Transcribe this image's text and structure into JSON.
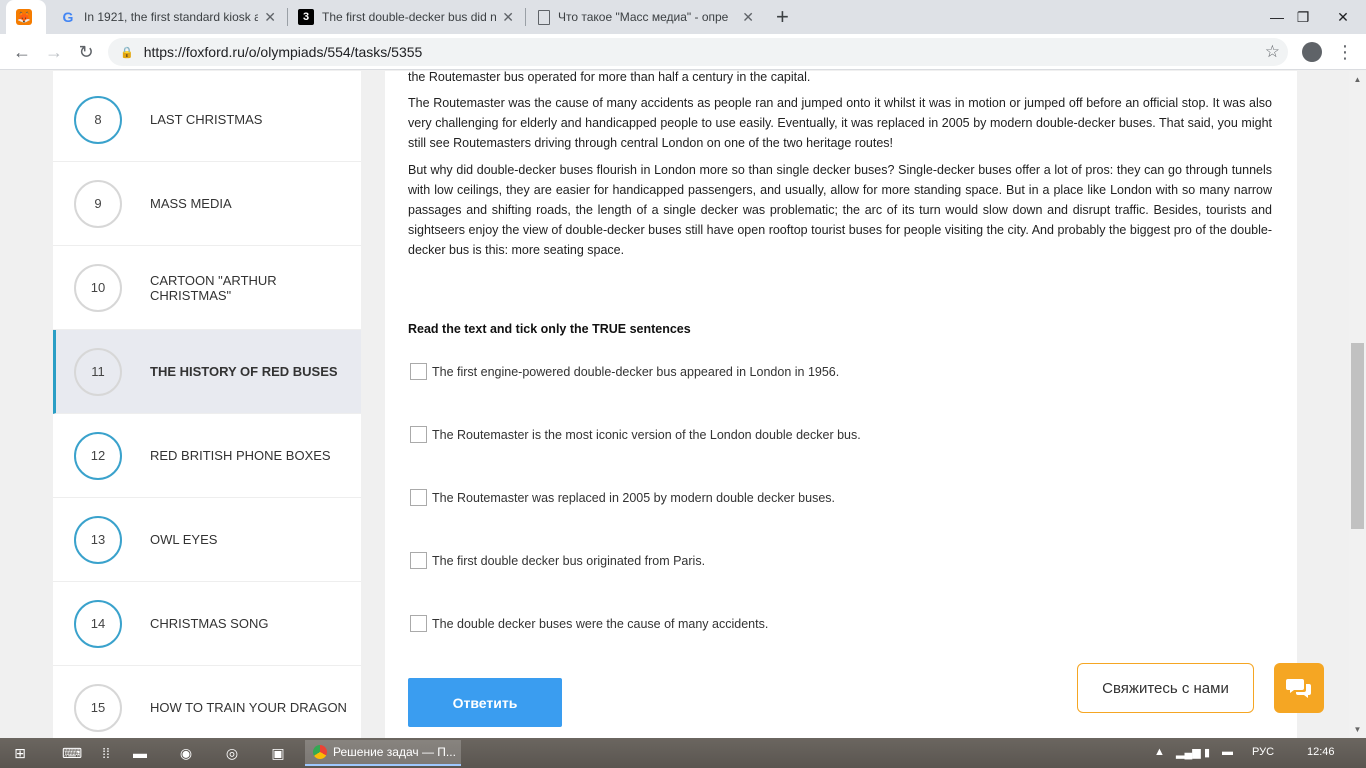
{
  "browser": {
    "tabs": [
      {
        "title": "In 1921, the first standard kiosk a",
        "favicon": "google-icon"
      },
      {
        "title": "The first double-decker bus did n",
        "favicon": "three-icon"
      },
      {
        "title": "Что такое \"Масс медиа\" - опре",
        "favicon": "document-icon"
      }
    ],
    "url": "https://foxford.ru/o/olympiads/554/tasks/5355",
    "new_tab": "+"
  },
  "sidebar": {
    "items": [
      {
        "num": "8",
        "label": "LAST CHRISTMAS",
        "active": false
      },
      {
        "num": "9",
        "label": "MASS MEDIA",
        "active": false
      },
      {
        "num": "10",
        "label": "CARTOON \"ARTHUR CHRISTMAS\"",
        "active": false
      },
      {
        "num": "11",
        "label": "THE HISTORY OF RED BUSES",
        "active": true
      },
      {
        "num": "12",
        "label": "RED BRITISH PHONE BOXES",
        "active": false
      },
      {
        "num": "13",
        "label": "OWL EYES",
        "active": false
      },
      {
        "num": "14",
        "label": "CHRISTMAS SONG",
        "active": false
      },
      {
        "num": "15",
        "label": "HOW TO TRAIN YOUR DRAGON",
        "active": false
      }
    ]
  },
  "content": {
    "paragraphs": [
      "the Routemaster bus operated for more than half a century in the capital.",
      "The Routemaster was the cause of many accidents as people ran and jumped onto it whilst it was in motion or jumped off before an official stop. It was also very challenging for elderly and handicapped people to use easily. Eventually, it was replaced in 2005 by modern double-decker buses. That said, you might still see Routemasters driving through central London on one of the two heritage routes!",
      "But why did double-decker buses flourish in London more so than single decker buses? Single-decker buses offer a lot of pros: they can go through tunnels with low ceilings, they are easier for handicapped passengers, and usually, allow for more standing space. But in a place like London with so many narrow passages and shifting roads, the length of a single decker was problematic; the arc of its turn would slow down and disrupt traffic. Besides, tourists and sightseers enjoy the view of double-decker buses still have open rooftop tourist buses for people visiting the city. And probably the biggest pro of the double-decker bus is this: more seating space."
    ],
    "question": "Read the text and tick only the TRUE sentences",
    "options": [
      "The first engine-powered double-decker bus appeared in London in 1956.",
      "The Routemaster is the most iconic version of the London double decker bus.",
      "The Routemaster was replaced in 2005 by modern double decker buses.",
      "The first double decker bus originated from Paris.",
      "The double decker buses were the cause of many accidents."
    ],
    "submit_label": "Ответить",
    "contact_label": "Свяжитесь с нами"
  },
  "taskbar": {
    "active_app": "Решение задач — П...",
    "lang": "РУС",
    "time": "12:46"
  },
  "colors": {
    "accent_blue": "#3a9df0",
    "ring_blue": "#3aa2cc",
    "orange": "#f5a623"
  }
}
